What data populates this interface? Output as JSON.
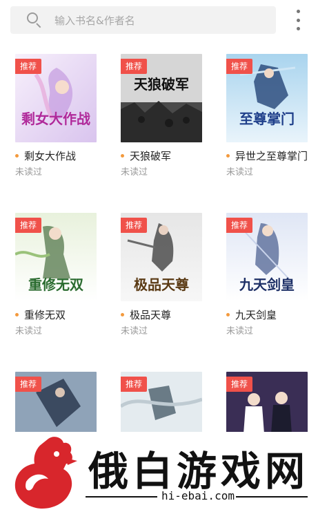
{
  "search": {
    "placeholder": "输入书名&作者名"
  },
  "books": [
    {
      "title": "剩女大作战",
      "status": "未读过",
      "badge": "推荐",
      "cover_text": "剩女大作战"
    },
    {
      "title": "天狼破军",
      "status": "未读过",
      "badge": "推荐",
      "cover_text": "天狼破军"
    },
    {
      "title": "异世之至尊掌门",
      "status": "未读过",
      "badge": "推荐",
      "cover_text": "至尊掌门"
    },
    {
      "title": "重修无双",
      "status": "未读过",
      "badge": "推荐",
      "cover_text": "重修无双"
    },
    {
      "title": "极品天尊",
      "status": "未读过",
      "badge": "推荐",
      "cover_text": "极品天尊"
    },
    {
      "title": "九天剑皇",
      "status": "未读过",
      "badge": "推荐",
      "cover_text": "九天剑皇"
    },
    {
      "badge": "推荐"
    },
    {
      "badge": "推荐"
    },
    {
      "badge": "推荐"
    }
  ],
  "watermark": {
    "brand": "俄白游戏网",
    "url": "hi-ebai.com"
  },
  "colors": {
    "badge": "#f0514a",
    "dot": "#f39a3d",
    "search_bg": "#f2f2f2"
  },
  "icons": {
    "search": "search-icon",
    "more": "more-vertical-icon"
  }
}
